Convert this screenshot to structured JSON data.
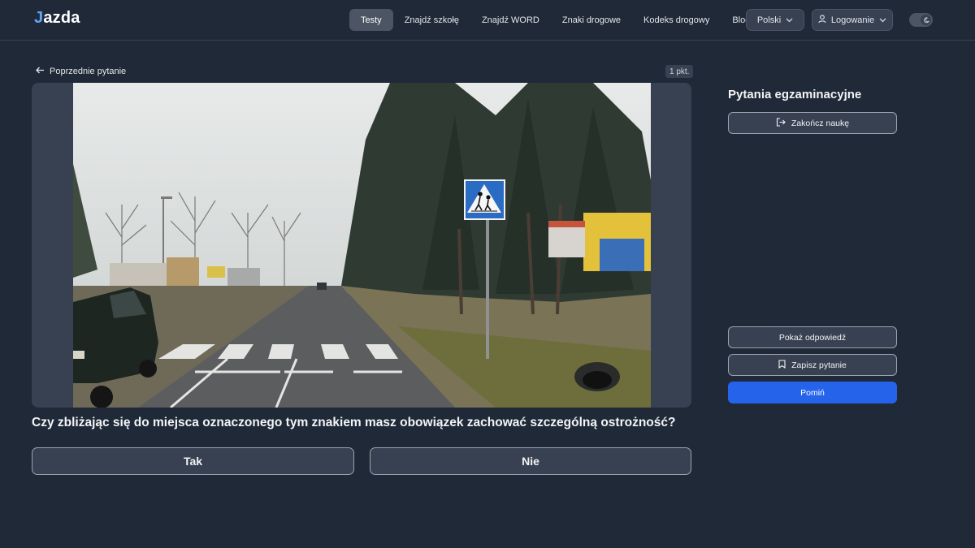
{
  "header": {
    "logo": {
      "mark": "J",
      "text": "azda"
    },
    "nav": [
      "Testy",
      "Znajdź szkołę",
      "Znajdź WORD",
      "Znaki drogowe",
      "Kodeks drogowy",
      "Blog"
    ],
    "active_nav": "Testy",
    "language": "Polski",
    "login_label": "Logowanie",
    "theme_icon": "moon-icon"
  },
  "question": {
    "back_label": "Poprzednie pytanie",
    "points": "1 pkt.",
    "text": "Czy zbliżając się do miejsca oznaczonego tym znakiem masz obowiązek zachować szczególną ostrożność?",
    "answers": [
      "Tak",
      "Nie"
    ]
  },
  "sidebar": {
    "title": "Pytania egzaminacyjne",
    "end_label": "Zakończ naukę",
    "show_answer_label": "Pokaż odpowiedź",
    "save_label": "Zapisz pytanie",
    "skip_label": "Pomiń"
  },
  "colors": {
    "background": "#1f2937",
    "primary": "#2563eb",
    "logo_accent": "#60a5fa"
  }
}
